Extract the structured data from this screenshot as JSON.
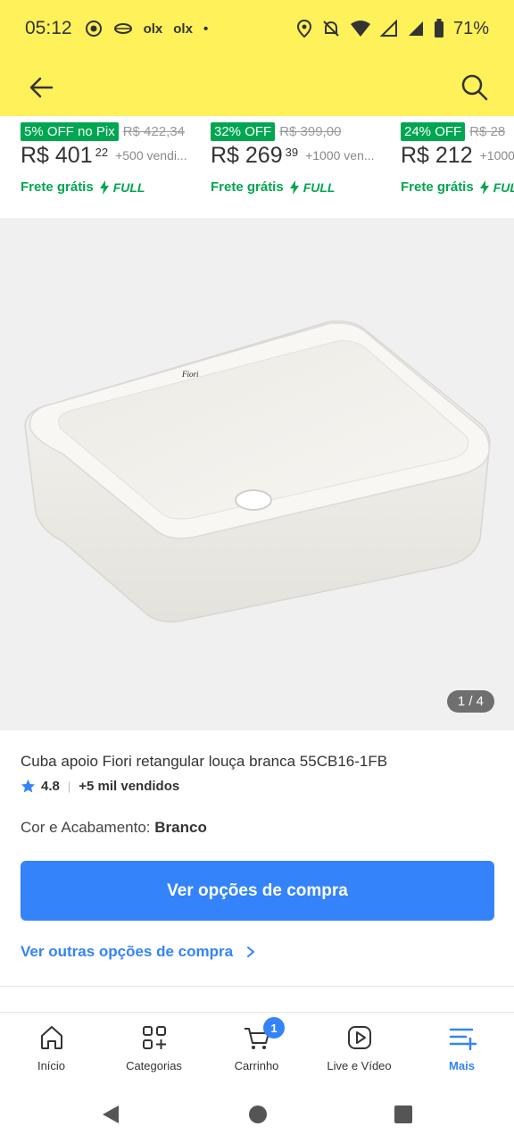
{
  "status_bar": {
    "time": "05:12",
    "left_icons": [
      "whatsapp-icon",
      "settings-icon",
      "olx",
      "olx"
    ],
    "notif_dot": "•",
    "battery": "71%"
  },
  "app_bar": {
    "back_icon": "arrow-left-icon",
    "search_icon": "search-icon"
  },
  "related_products": [
    {
      "discount": "5% OFF no Pix",
      "old_price": "R$ 422,34",
      "price": "R$ 401",
      "cents": "22",
      "sold": "+500 vendi...",
      "shipping": "Frete grátis",
      "full": "FULL"
    },
    {
      "discount": "32% OFF",
      "old_price": "R$ 399,00",
      "price": "R$ 269",
      "cents": "39",
      "sold": "+1000 ven...",
      "shipping": "Frete grátis",
      "full": "FULL"
    },
    {
      "discount": "24% OFF",
      "old_price": "R$ 28",
      "price": "R$ 212",
      "cents": "",
      "sold": "+1000",
      "shipping": "Frete grátis",
      "full": "FUL"
    }
  ],
  "gallery": {
    "counter": "1 / 4",
    "brand_mark": "Fiori"
  },
  "product": {
    "title": "Cuba apoio Fiori retangular louça branca 55CB16-1FB",
    "rating": "4.8",
    "sold": "+5 mil vendidos",
    "variant_label": "Cor e Acabamento:",
    "variant_value": "Branco"
  },
  "actions": {
    "primary_cta": "Ver opções de compra",
    "secondary_link": "Ver outras opções de compra"
  },
  "bottom_nav": [
    {
      "label": "Início",
      "icon": "home-icon",
      "active": false
    },
    {
      "label": "Categorias",
      "icon": "categories-icon",
      "active": false
    },
    {
      "label": "Carrinho",
      "icon": "cart-icon",
      "active": false,
      "badge": "1"
    },
    {
      "label": "Live e Vídeo",
      "icon": "play-video-icon",
      "active": false
    },
    {
      "label": "Mais",
      "icon": "menu-more-icon",
      "active": true
    }
  ],
  "colors": {
    "brand_yellow": "#fff159",
    "primary_blue": "#3483fa",
    "discount_green": "#00a650"
  }
}
